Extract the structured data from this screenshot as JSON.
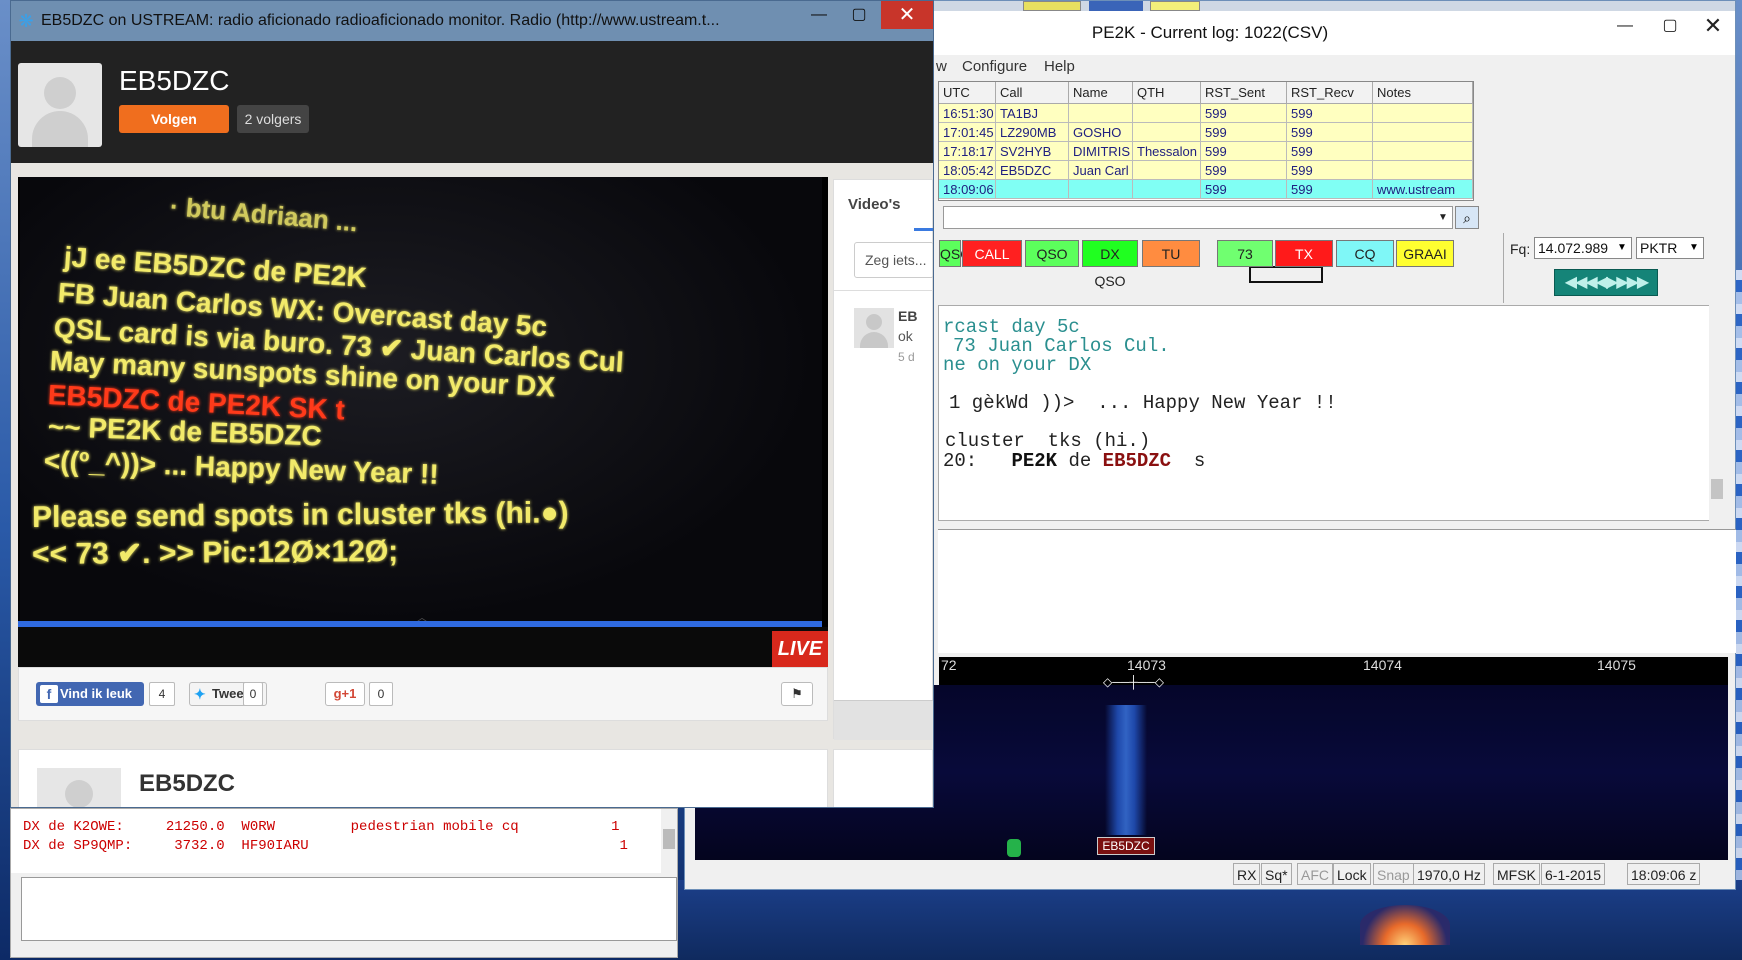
{
  "fldigi": {
    "title": "PE2K - Current log: 1022(CSV)",
    "window_controls": {
      "minimize": "—",
      "maximize": "▢",
      "close": "✕"
    },
    "menu": [
      "w",
      "Configure",
      "Help"
    ],
    "log_table": {
      "columns": [
        "UTC",
        "Call",
        "Name",
        "QTH",
        "RST_Sent",
        "RST_Recv",
        "Notes"
      ],
      "rows": [
        [
          "16:51:30",
          "TA1BJ",
          "",
          "",
          "599",
          "599",
          ""
        ],
        [
          "17:01:45",
          "LZ290MB",
          "GOSHO",
          "",
          "599",
          "599",
          ""
        ],
        [
          "17:18:17",
          "SV2HYB",
          "DIMITRIS",
          "Thessalon",
          "599",
          "599",
          ""
        ],
        [
          "18:05:42",
          "EB5DZC",
          "Juan Carl",
          "",
          "599",
          "599",
          ""
        ],
        [
          "18:09:06",
          "",
          "",
          "",
          "599",
          "599",
          "www.ustream"
        ]
      ]
    },
    "macro_buttons": [
      {
        "label": "QSO",
        "color": "#5cff5c"
      },
      {
        "label": "CALL",
        "color": "#ff2020"
      },
      {
        "label": "QSO",
        "color": "#5cff5c"
      },
      {
        "label": "DX QSO",
        "color": "#20ff20"
      },
      {
        "label": "TU",
        "color": "#ff8c40"
      },
      {
        "label": "73",
        "color": "#70ff70"
      },
      {
        "label": "TX",
        "color": "#ff1a1a"
      },
      {
        "label": "CQ",
        "color": "#7ff7f7"
      },
      {
        "label": "GRAAI",
        "color": "#ffff30"
      }
    ],
    "freq_label": "Fq:",
    "frequency": "14.072.989",
    "mode": "PKTR",
    "tune_arrows": "◀◀◀◀▶▶▶▶",
    "rx_text": {
      "line1": "rcast day 5c",
      "line2": "73 Juan Carlos Cul.",
      "line3": "ne on your DX",
      "line4": "1 gèkWd ))>  ... Happy New Year !!",
      "line5": "cluster  tks (hi.)",
      "line6_prefix": "20:",
      "line6_call1": "PE2K",
      "line6_de": "de",
      "line6_call2": "EB5DZC",
      "line6_suffix": "s"
    },
    "waterfall_scale": [
      "72",
      "14073",
      "14074",
      "14075"
    ],
    "waterfall_label": "EB5DZC",
    "status": {
      "rx": "RX",
      "sq": "Sq*",
      "afc": "AFC",
      "lock": "Lock",
      "snap": "Snap",
      "offset": "1970,0 Hz",
      "mode": "MFSK",
      "date": "6-1-2015",
      "time": "18:09:06 z"
    }
  },
  "cluster": {
    "lines": [
      "DX de K2OWE:     21250.0  W0RW         pedestrian mobile cq           1",
      "DX de SP9QMP:     3732.0  HF90IARU                                     1"
    ]
  },
  "ustream": {
    "title": "EB5DZC on USTREAM: radio aficionado radioaficionado monitor. Radio (http://www.ustream.t...",
    "window_controls": {
      "minimize": "—",
      "maximize": "▢",
      "close": "✕"
    },
    "channel_name": "EB5DZC",
    "follow_label": "Volgen",
    "followers_label": "2 volgers",
    "video_lines": [
      {
        "text": "· btu Adriaan ..."
      },
      {
        "text": "jJ ee EB5DZC de PE2K"
      },
      {
        "text": "FB Juan Carlos WX: Overcast day 5c"
      },
      {
        "text": "QSL card is via buro. 73 ✔ Juan Carlos Cul"
      },
      {
        "text": "May many sunspots shine on your DX"
      },
      {
        "text": "EB5DZC de PE2K SK t"
      },
      {
        "text": "~~ PE2K de EB5DZC"
      },
      {
        "text": "<((º_^))>  ... Happy New Year !!"
      },
      {
        "text": "Please send spots in cluster  tks (hi.●)"
      },
      {
        "text": "<< 73 ✔. >>  Pic:12Ø×12Ø;"
      }
    ],
    "live_label": "LIVE",
    "social": {
      "like_label": "Vind ik leuk",
      "like_count": "4",
      "tweet_label": "Tweet",
      "tweet_count": "0",
      "gplus_label": "g+1",
      "gplus_count": "0",
      "flag_icon": "⚑"
    },
    "sidebar": {
      "tab_label": "Video's",
      "comment_placeholder": "Zeg iets...",
      "comment_name": "EB",
      "comment_text": "ok",
      "comment_time": "5 d"
    },
    "card_name": "EB5DZC"
  }
}
